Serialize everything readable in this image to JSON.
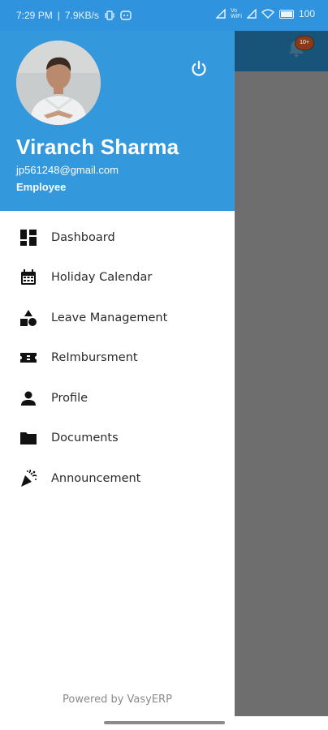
{
  "status_bar": {
    "time": "7:29 PM",
    "speed": "7.9KB/s",
    "network_label": "Vo\nWiFi",
    "battery": "100"
  },
  "app": {
    "notification_count": "10+"
  },
  "drawer": {
    "user": {
      "name": "Viranch Sharma",
      "email": "jp561248@gmail.com",
      "role": "Employee"
    },
    "menu": [
      {
        "label": "Dashboard",
        "icon": "dashboard-icon"
      },
      {
        "label": "Holiday Calendar",
        "icon": "calendar-icon"
      },
      {
        "label": "Leave Management",
        "icon": "shapes-icon"
      },
      {
        "label": "ReImbursment",
        "icon": "ticket-icon"
      },
      {
        "label": "Profile",
        "icon": "person-icon"
      },
      {
        "label": "Documents",
        "icon": "folder-icon"
      },
      {
        "label": "Announcement",
        "icon": "party-popper-icon"
      }
    ],
    "footer": "Powered by VasyERP"
  },
  "colors": {
    "primary": "#3498dc",
    "status_bar": "#2f93dd",
    "app_header": "#185379",
    "scrim": "#6e6e6e"
  }
}
